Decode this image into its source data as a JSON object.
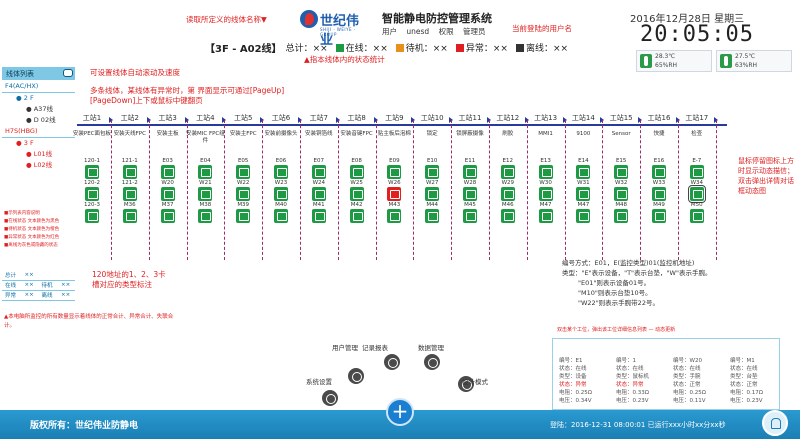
{
  "header": {
    "logo_text": "世纪伟业",
    "logo_sub": "SHIJI · WEIYE · GROUP",
    "system_title": "智能静电防控管理系统",
    "menu": [
      "用户",
      "unesd",
      "权限",
      "管理员"
    ],
    "annotation_left": "读取所定义的线体名称▼",
    "annotation_right": "当前登陆的用户名",
    "date": "2016年12月28日 星期三",
    "time": "20:05:05",
    "sensors": [
      {
        "temp": "28.3℃",
        "humid": "65%RH"
      },
      {
        "temp": "27.5℃",
        "humid": "63%RH"
      }
    ]
  },
  "status": {
    "line_name": "【3F - A02线】",
    "total": "总计：××",
    "online": "在线：××",
    "standby": "待机：××",
    "abnormal": "异常：××",
    "offline": "离线：××",
    "colors": {
      "online": "#1e9a45",
      "standby": "#e8901a",
      "abnormal": "#e02020",
      "offline": "#333333"
    },
    "annotation": "▲指本线体内的状态统计"
  },
  "sidebar": {
    "title": "线体列表",
    "tree": [
      {
        "label": "F4(AC/HX)",
        "level": "grp"
      },
      {
        "label": "● 2 F",
        "level": "lv1"
      },
      {
        "label": "● A37线",
        "level": "lv2"
      },
      {
        "label": "● D 02线",
        "level": "lv2"
      },
      {
        "label": "H7S(HBG)",
        "level": "grp"
      },
      {
        "label": "● 3 F",
        "level": "lv1"
      },
      {
        "label": "● L01线",
        "level": "lv2"
      },
      {
        "label": "● L02线",
        "level": "lv2"
      }
    ],
    "notes": [
      "■示列表内容说明",
      "■在线状态  文本颜色为黑色",
      "■待机状态  文本颜色为橙色",
      "■异常状态  文本颜色为红色",
      "■离线为灰色或隐藏的状态"
    ],
    "stats": [
      {
        "a": "总计",
        "b": "××"
      },
      {
        "a": "在线",
        "b": "××",
        "c": "待机",
        "d": "××"
      },
      {
        "a": "异常",
        "b": "××",
        "c": "离线",
        "d": "××"
      }
    ],
    "stats_annotation": "▲本电脑所监控的所有数量显示着线体的正常合计、异常合计、失联合计。"
  },
  "annotations": {
    "scroll": "可设置线体自动滚动及速度",
    "paging": "多条线体，某线体有异常时，第    界面显示可通过[PageUp][PageDown]上下或鼠标中键翻页",
    "slot": "120地址的1、2、3卡槽对应的类型标注",
    "hover": "鼠标停留图标上方时显示动态描信；双击弹出详情对话框动态图"
  },
  "stations": [
    {
      "name": "工站1",
      "desc": "安装PEC面包板",
      "devices": [
        {
          "label": "120-1",
          "st": "ok"
        },
        {
          "label": "120-2",
          "st": "ok"
        },
        {
          "label": "120-3",
          "st": "ok"
        }
      ]
    },
    {
      "name": "工站2",
      "desc": "安装天线FPC",
      "devices": [
        {
          "label": "121-1",
          "st": "ok"
        },
        {
          "label": "121-2",
          "st": "ok"
        },
        {
          "label": "M36",
          "st": "ok"
        }
      ]
    },
    {
      "name": "工站3",
      "desc": "安装主板",
      "devices": [
        {
          "label": "E03",
          "st": "ok"
        },
        {
          "label": "W20",
          "st": "ok"
        },
        {
          "label": "M37",
          "st": "ok"
        }
      ]
    },
    {
      "name": "工站4",
      "desc": "安装MIC FPC组件",
      "devices": [
        {
          "label": "E04",
          "st": "ok"
        },
        {
          "label": "W21",
          "st": "ok"
        },
        {
          "label": "M38",
          "st": "ok"
        }
      ]
    },
    {
      "name": "工站5",
      "desc": "安装主FPC",
      "devices": [
        {
          "label": "E05",
          "st": "ok"
        },
        {
          "label": "W22",
          "st": "ok"
        },
        {
          "label": "M39",
          "st": "ok"
        }
      ]
    },
    {
      "name": "工站6",
      "desc": "安装前摄像头",
      "devices": [
        {
          "label": "E06",
          "st": "ok"
        },
        {
          "label": "W23",
          "st": "ok"
        },
        {
          "label": "M40",
          "st": "ok"
        }
      ]
    },
    {
      "name": "工站7",
      "desc": "安装铜箔线",
      "devices": [
        {
          "label": "E07",
          "st": "ok"
        },
        {
          "label": "W24",
          "st": "ok"
        },
        {
          "label": "M41",
          "st": "ok"
        }
      ]
    },
    {
      "name": "工站8",
      "desc": "安装音键FPC",
      "devices": [
        {
          "label": "E08",
          "st": "ok"
        },
        {
          "label": "W25",
          "st": "ok"
        },
        {
          "label": "M42",
          "st": "ok"
        }
      ]
    },
    {
      "name": "工站9",
      "desc": "贴主板后泡棉",
      "devices": [
        {
          "label": "E09",
          "st": "ok"
        },
        {
          "label": "W26",
          "st": "err"
        },
        {
          "label": "M43",
          "st": "ok"
        }
      ]
    },
    {
      "name": "工站10",
      "desc": "锁定",
      "devices": [
        {
          "label": "E10",
          "st": "ok"
        },
        {
          "label": "W27",
          "st": "ok"
        },
        {
          "label": "M44",
          "st": "ok"
        }
      ]
    },
    {
      "name": "工站11",
      "desc": "锁屏蔽摄像",
      "devices": [
        {
          "label": "E11",
          "st": "ok"
        },
        {
          "label": "W28",
          "st": "ok"
        },
        {
          "label": "M45",
          "st": "ok"
        }
      ]
    },
    {
      "name": "工站12",
      "desc": "刷胶",
      "devices": [
        {
          "label": "E12",
          "st": "ok"
        },
        {
          "label": "W29",
          "st": "ok"
        },
        {
          "label": "M46",
          "st": "ok"
        }
      ]
    },
    {
      "name": "工站13",
      "desc": "MMI1",
      "devices": [
        {
          "label": "E13",
          "st": "ok"
        },
        {
          "label": "W30",
          "st": "ok"
        },
        {
          "label": "M47",
          "st": "ok"
        }
      ]
    },
    {
      "name": "工站14",
      "desc": "9100",
      "devices": [
        {
          "label": "E14",
          "st": "ok"
        },
        {
          "label": "W31",
          "st": "ok"
        },
        {
          "label": "M47",
          "st": "ok"
        }
      ]
    },
    {
      "name": "工站15",
      "desc": "Sensor",
      "devices": [
        {
          "label": "E15",
          "st": "ok"
        },
        {
          "label": "W32",
          "st": "ok"
        },
        {
          "label": "M48",
          "st": "ok"
        }
      ]
    },
    {
      "name": "工站16",
      "desc": "快捷",
      "devices": [
        {
          "label": "E16",
          "st": "ok"
        },
        {
          "label": "W33",
          "st": "ok"
        },
        {
          "label": "M49",
          "st": "ok"
        }
      ]
    },
    {
      "name": "工站17",
      "desc": "检查",
      "devices": [
        {
          "label": "E-7",
          "st": "ok"
        },
        {
          "label": "W34",
          "st": "sel"
        },
        {
          "label": "M50",
          "st": "ok"
        }
      ]
    }
  ],
  "legend_block": [
    "编号方式：E01，E(监控类型)01(监控机地址)",
    "类型：\"E\"表示设备，\"T\"表示台垫，\"W\"表示手腕。",
    "\"E01\"则表示设备01号。",
    "\"M10\"则表示台垫10号。",
    "\"W22\"则表示手腕带22号。"
  ],
  "popup": {
    "caption": "双击某个工位，弹出该工位详细信息列表 — 动态更新",
    "cols": [
      [
        "编号：E1",
        "状态：在线",
        "类型：设备",
        "状态：异常",
        "电阻：0.25Ω",
        "电压：0.34V"
      ],
      [
        "编号：1",
        "状态：在线",
        "类型：鼠标机",
        "状态：异常",
        "电阻：0.33Ω",
        "电压：0.23V"
      ],
      [
        "编号：W20",
        "状态：在线",
        "类型：手腕",
        "状态：正常",
        "电阻：0.25Ω",
        "电压：0.11V"
      ],
      [
        "编号：M1",
        "状态：在线",
        "类型：台垫",
        "状态：正常",
        "电阻：0.17Ω",
        "电压：0.23V"
      ]
    ]
  },
  "nav": {
    "items": [
      "系统设置",
      "用户管理",
      "记录报表",
      "数据管理",
      "设计模式"
    ],
    "plus": "+"
  },
  "footer": {
    "copyright": "版权所有：世纪伟业防静电",
    "login": "登陆：2016-12-31  08:00:01  已运行xxx小时xx分xx秒"
  }
}
